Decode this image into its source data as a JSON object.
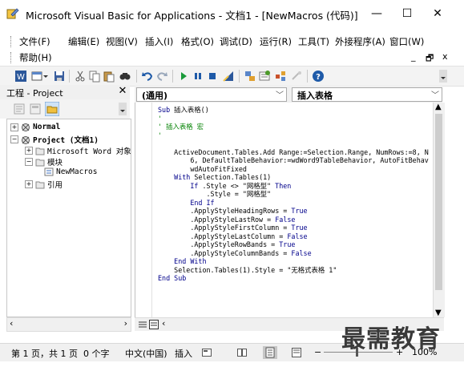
{
  "window": {
    "title": "Microsoft Visual Basic for Applications - 文档1 - [NewMacros (代码)]",
    "minimize": "—",
    "maximize": "☐",
    "close": "✕"
  },
  "menu": {
    "items": [
      "文件(F)",
      "编辑(E)",
      "视图(V)",
      "插入(I)",
      "格式(O)",
      "调试(D)",
      "运行(R)",
      "工具(T)",
      "外接程序(A)",
      "窗口(W)"
    ],
    "help": "帮助(H)",
    "mdi_minimize": "_",
    "mdi_restore": "🗗",
    "mdi_close": "x"
  },
  "project_panel": {
    "title": "工程 - Project",
    "close": "✕",
    "tree": {
      "normal": "Normal",
      "project": "Project (文档1)",
      "word_objects": "Microsoft Word 对象",
      "modules": "模块",
      "newmacros": "NewMacros",
      "references": "引用"
    }
  },
  "code_window": {
    "object_combo": "(通用)",
    "proc_combo": "插入表格",
    "lines": [
      {
        "parts": [
          {
            "t": "Sub ",
            "c": "kw"
          },
          {
            "t": "插入表格()",
            "c": ""
          }
        ]
      },
      {
        "parts": [
          {
            "t": "'",
            "c": "cm"
          }
        ]
      },
      {
        "parts": [
          {
            "t": "' 插入表格 宏",
            "c": "cm"
          }
        ]
      },
      {
        "parts": [
          {
            "t": "'",
            "c": "cm"
          }
        ]
      },
      {
        "parts": [
          {
            "t": "",
            "c": ""
          }
        ]
      },
      {
        "parts": [
          {
            "t": "    ActiveDocument.Tables.Add Range:=Selection.Range, NumRows:=8, N",
            "c": ""
          }
        ]
      },
      {
        "parts": [
          {
            "t": "        6, DefaultTableBehavior:=wdWord9TableBehavior, AutoFitBehav",
            "c": ""
          }
        ]
      },
      {
        "parts": [
          {
            "t": "        wdAutoFitFixed",
            "c": ""
          }
        ]
      },
      {
        "parts": [
          {
            "t": "    With ",
            "c": "kw"
          },
          {
            "t": "Selection.Tables(1)",
            "c": ""
          }
        ]
      },
      {
        "parts": [
          {
            "t": "        If ",
            "c": "kw"
          },
          {
            "t": ".Style <> \"网格型\" ",
            "c": ""
          },
          {
            "t": "Then",
            "c": "kw"
          }
        ]
      },
      {
        "parts": [
          {
            "t": "            .Style = \"网格型\"",
            "c": ""
          }
        ]
      },
      {
        "parts": [
          {
            "t": "        End If",
            "c": "kw"
          }
        ]
      },
      {
        "parts": [
          {
            "t": "        .ApplyStyleHeadingRows = ",
            "c": ""
          },
          {
            "t": "True",
            "c": "kw"
          }
        ]
      },
      {
        "parts": [
          {
            "t": "        .ApplyStyleLastRow = ",
            "c": ""
          },
          {
            "t": "False",
            "c": "kw"
          }
        ]
      },
      {
        "parts": [
          {
            "t": "        .ApplyStyleFirstColumn = ",
            "c": ""
          },
          {
            "t": "True",
            "c": "kw"
          }
        ]
      },
      {
        "parts": [
          {
            "t": "        .ApplyStyleLastColumn = ",
            "c": ""
          },
          {
            "t": "False",
            "c": "kw"
          }
        ]
      },
      {
        "parts": [
          {
            "t": "        .ApplyStyleRowBands = ",
            "c": ""
          },
          {
            "t": "True",
            "c": "kw"
          }
        ]
      },
      {
        "parts": [
          {
            "t": "        .ApplyStyleColumnBands = ",
            "c": ""
          },
          {
            "t": "False",
            "c": "kw"
          }
        ]
      },
      {
        "parts": [
          {
            "t": "    End With",
            "c": "kw"
          }
        ]
      },
      {
        "parts": [
          {
            "t": "    Selection.Tables(1).Style = \"无格式表格 1\"",
            "c": ""
          }
        ]
      },
      {
        "parts": [
          {
            "t": "End Sub",
            "c": "kw"
          }
        ]
      }
    ]
  },
  "statusbar": {
    "page": "第 1 页，共 1 页",
    "words": "0 个字",
    "language": "中文(中国)",
    "insert": "插入",
    "zoom": "100%",
    "zoom_minus": "−",
    "zoom_plus": "+"
  },
  "watermark": "最需教育",
  "colors": {
    "keyword": "#00008b",
    "comment": "#008000",
    "accent": "#1e5aa8"
  }
}
